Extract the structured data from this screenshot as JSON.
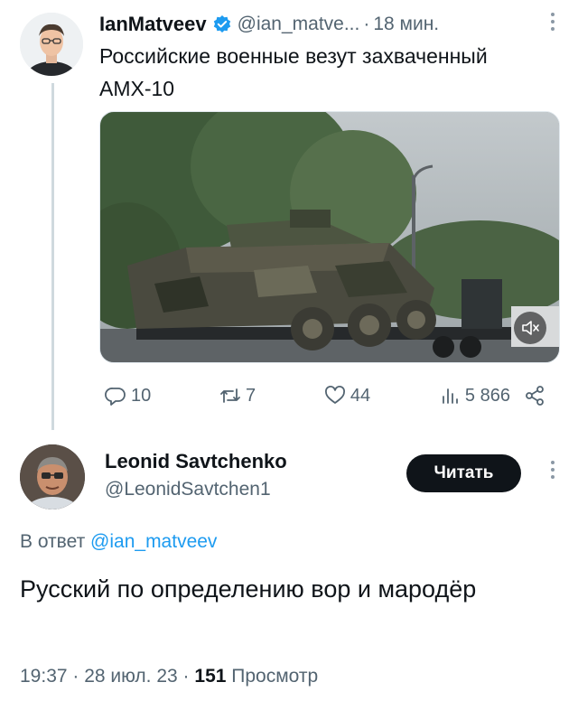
{
  "tweet": {
    "author_name": "IanMatveev",
    "handle": "@ian_matve...",
    "separator": "·",
    "time": "18 мин.",
    "text": "Российские военные везут захваченный AMX-10",
    "media": {
      "type": "video",
      "muted": true
    },
    "actions": {
      "reply_count": "10",
      "retweet_count": "7",
      "like_count": "44",
      "views_count": "5 866"
    }
  },
  "reply": {
    "author_name": "Leonid Savtchenko",
    "handle": "@LeonidSavtchen1",
    "follow_label": "Читать",
    "reply_prefix": "В ответ",
    "reply_mention": "@ian_matveev",
    "text": "Русский по определению вор и мародёр",
    "timestamp": "19:37 · 28 июл. 23 ·",
    "views_number": "151",
    "views_label": "Просмотр"
  },
  "icons": {
    "verified": "verified-badge-icon",
    "reply": "reply-icon",
    "retweet": "retweet-icon",
    "like": "heart-icon",
    "views": "views-icon",
    "share": "share-icon",
    "mute": "mute-icon",
    "more": "more-icon"
  },
  "colors": {
    "accent": "#1d9bf0",
    "text": "#0f1419",
    "muted": "#536471",
    "button_bg": "#0f1419"
  }
}
